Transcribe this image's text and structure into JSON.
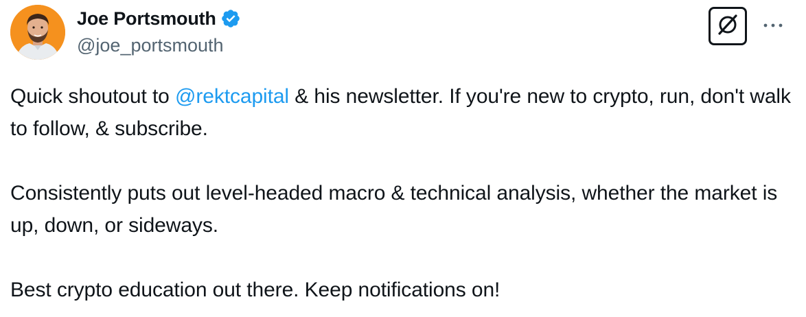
{
  "user": {
    "display_name": "Joe Portsmouth",
    "handle": "@joe_portsmouth",
    "verified": true,
    "avatar_background": "#f5911e"
  },
  "icons": {
    "verified": "verified-badge-icon",
    "grok": "grok-icon",
    "more": "more-options-icon"
  },
  "colors": {
    "text": "#0f1419",
    "secondary_text": "#536471",
    "link": "#1d9bf0",
    "verified_badge": "#1d9bf0"
  },
  "tweet": {
    "paragraphs": [
      {
        "before": "Quick shoutout to ",
        "mention": "@rektcapital",
        "after": " & his newsletter. If you're new to crypto, run, don't walk to follow, & subscribe."
      },
      {
        "text": "Consistently puts out level-headed macro & technical analysis, whether the market is up, down, or sideways."
      },
      {
        "text": "Best crypto education out there. Keep notifications on!"
      }
    ]
  }
}
